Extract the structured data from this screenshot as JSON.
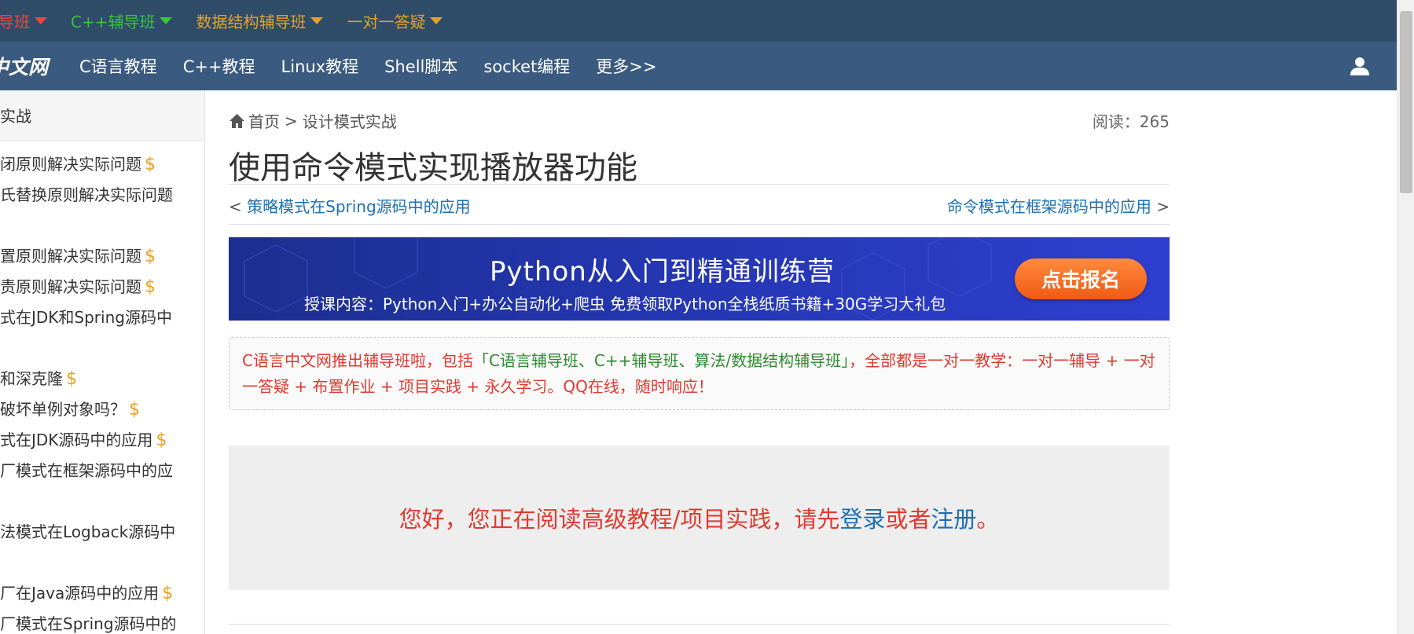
{
  "promo_bar": {
    "items": [
      {
        "label": "导班",
        "color": "#e84b3c"
      },
      {
        "label": "C++辅导班",
        "color": "#3cc43c"
      },
      {
        "label": "数据结构辅导班",
        "color": "#e3a32b"
      },
      {
        "label": "一对一答疑",
        "color": "#e3a32b"
      }
    ]
  },
  "nav": {
    "logo": "中文网",
    "links": [
      "C语言教程",
      "C++教程",
      "Linux教程",
      "Shell脚本",
      "socket编程",
      "更多>>"
    ],
    "user_icon": "user-icon"
  },
  "sidebar": {
    "header": "实战",
    "items": [
      {
        "label": "闭原则解决实际问题",
        "paid": "$"
      },
      {
        "label": "氏替换原则解决实际问题",
        "paid": ""
      },
      {
        "label": "置原则解决实际问题",
        "paid": "$"
      },
      {
        "label": "责原则解决实际问题",
        "paid": "$"
      },
      {
        "label": "式在JDK和Spring源码中",
        "paid": ""
      },
      {
        "label": "和深克隆",
        "paid": "$"
      },
      {
        "label": "破坏单例对象吗？",
        "paid": "$"
      },
      {
        "label": "式在JDK源码中的应用",
        "paid": "$"
      },
      {
        "label": "厂模式在框架源码中的应",
        "paid": ""
      },
      {
        "label": "法模式在Logback源码中",
        "paid": ""
      },
      {
        "label": "厂在Java源码中的应用",
        "paid": "$"
      },
      {
        "label": "厂模式在Spring源码中的",
        "paid": ""
      }
    ]
  },
  "content": {
    "breadcrumb": {
      "home": "首页",
      "separator": ">",
      "section": "设计模式实战"
    },
    "read_count": "阅读：265",
    "title": "使用命令模式实现播放器功能",
    "prev": {
      "marker": "<",
      "label": "策略模式在Spring源码中的应用"
    },
    "next": {
      "label": "命令模式在框架源码中的应用",
      "marker": ">"
    },
    "banner": {
      "title": "Python从入门到精通训练营",
      "subtitle": "授课内容：Python入门+办公自动化+爬虫        免费领取Python全栈纸质书籍+30G学习大礼包",
      "cta": "点击报名"
    },
    "notice": {
      "part1": "C语言中文网推出辅导班啦，包括",
      "part2": "「C语言辅导班、C++辅导班、算法/数据结构辅导班」",
      "part3": "，全部都是一对一教学：一对一辅导 + 一对一答疑 + 布置作业 + 项目实践 + 永久学习。QQ在线，随时响应！"
    },
    "login_prompt": {
      "text": "您好，您正在阅读高级教程/项目实践，请先 ",
      "login": "登录",
      "or": " 或者 ",
      "register": "注册",
      "end": "。"
    }
  }
}
